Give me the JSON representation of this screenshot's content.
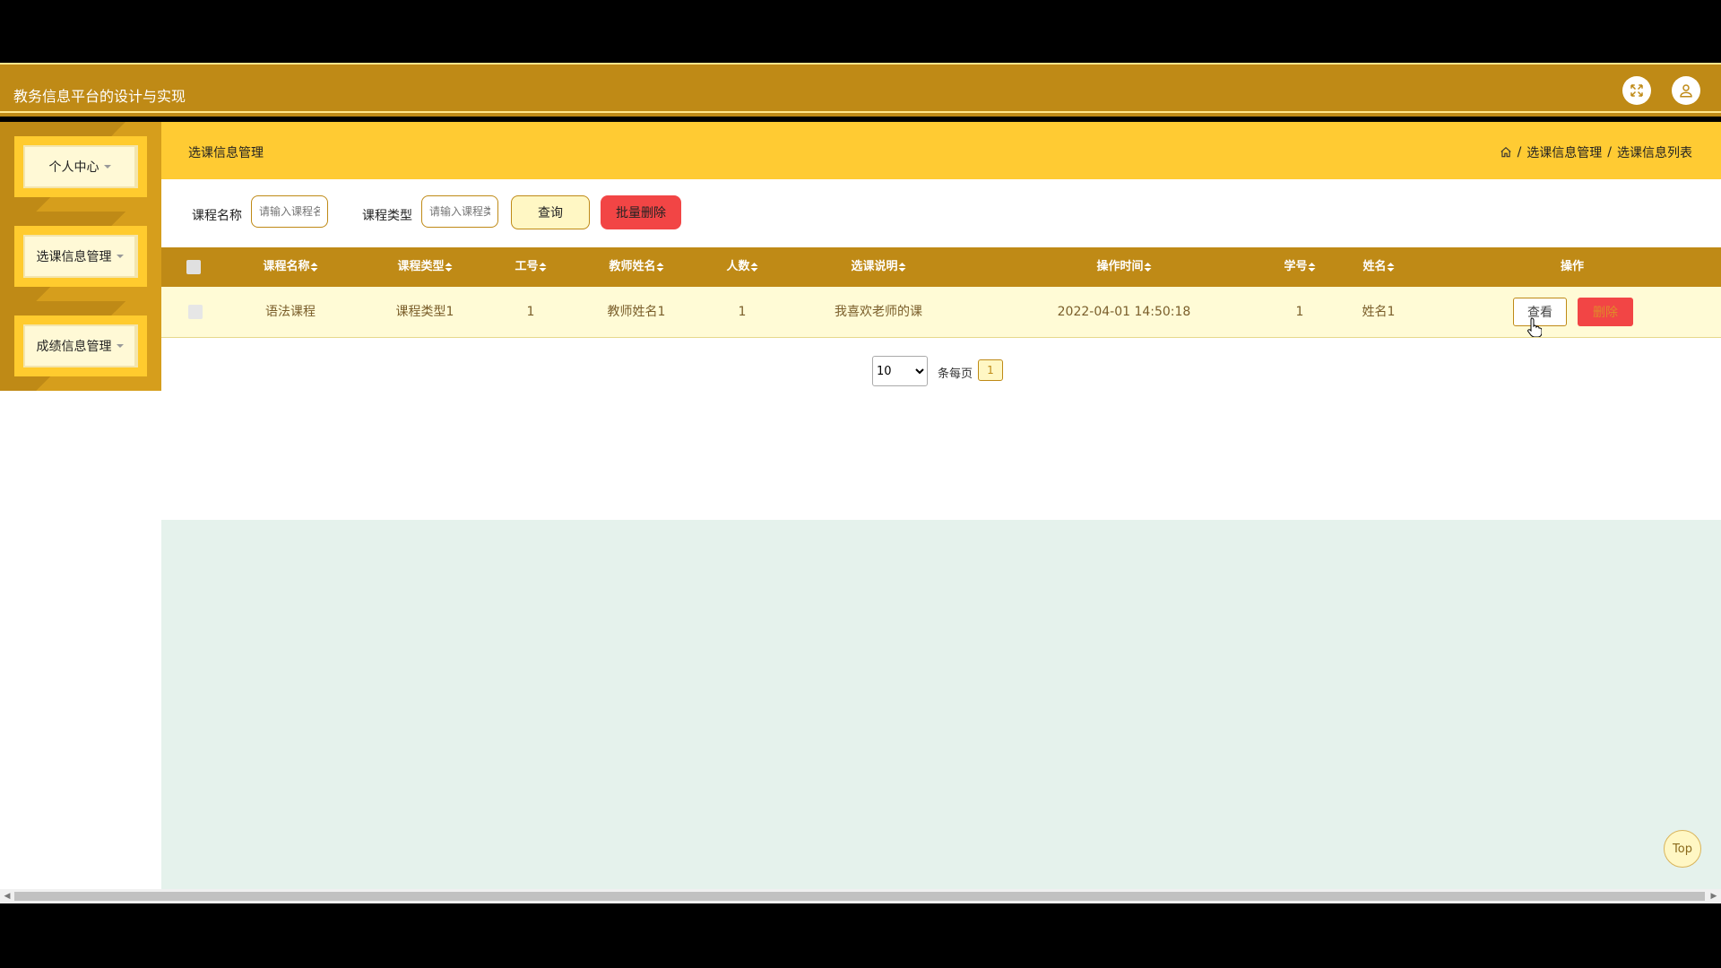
{
  "app": {
    "title": "教务信息平台的设计与实现"
  },
  "icons": {
    "fullscreen": "fullscreen-icon",
    "user": "user-icon",
    "home": "home-icon"
  },
  "sidebar": {
    "items": [
      {
        "label": "个人中心"
      },
      {
        "label": "选课信息管理"
      },
      {
        "label": "成绩信息管理"
      }
    ]
  },
  "header": {
    "page_title": "选课信息管理",
    "breadcrumb": [
      "选课信息管理",
      "选课信息列表"
    ]
  },
  "search": {
    "course_name_label": "课程名称",
    "course_name_placeholder": "请输入课程名称",
    "course_type_label": "课程类型",
    "course_type_placeholder": "请输入课程类型",
    "query_button": "查询",
    "batch_delete_button": "批量删除"
  },
  "table": {
    "columns": [
      "课程名称",
      "课程类型",
      "工号",
      "教师姓名",
      "人数",
      "选课说明",
      "操作时间",
      "学号",
      "姓名",
      "操作"
    ],
    "rows": [
      [
        "语法课程",
        "课程类型1",
        "1",
        "教师姓名1",
        "1",
        "我喜欢老师的课",
        "2022-04-01 14:50:18",
        "1",
        "姓名1"
      ]
    ],
    "view_button": "查看",
    "delete_button": "删除"
  },
  "pagination": {
    "page_size": "10",
    "per_page_label": "条每页",
    "current_page": "1"
  },
  "back_to_top": "Top",
  "colors": {
    "primary": "#BF8A16",
    "header": "#FFCB33",
    "danger": "#F24545",
    "row_bg": "#FFFBD6"
  }
}
